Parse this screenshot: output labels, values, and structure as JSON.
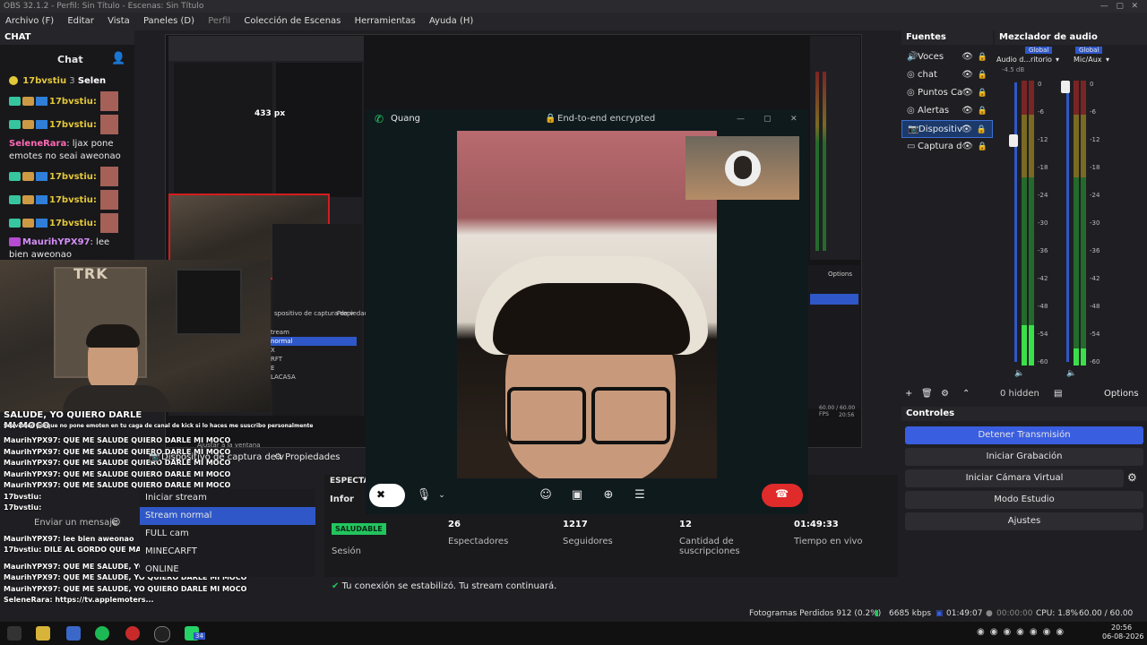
{
  "window": {
    "title": "OBS 32.1.2 - Perfil: Sin Título - Escenas: Sin Título",
    "menu": [
      "Archivo (F)",
      "Editar",
      "Vista",
      "Paneles (D)",
      "Perfil",
      "Colección de Escenas",
      "Herramientas",
      "Ayuda (H)"
    ]
  },
  "chat": {
    "dock_title": "CHAT",
    "header": "Chat",
    "top_user": "17bvstiu",
    "top_count": "3",
    "top_user2": "Selen",
    "lines": [
      {
        "user": "17bvstiu:"
      },
      {
        "user": "17bvstiu:"
      }
    ],
    "msg1_user": "SeleneRara",
    "msg1_text": ": ljax pone emotes no seai aweonao",
    "lines2": [
      {
        "user": "17bvstiu:"
      },
      {
        "user": "17bvstiu:"
      },
      {
        "user": "17bvstiu:"
      }
    ],
    "msg2_user": "MaurihYPX97",
    "msg2_text": ": lee bien aweonao"
  },
  "overlay_chat": [
    "SALUDE, YO QUIERO DARLE",
    "MI MOCO",
    "MaurihYPX97: QUE ME SALUDE QUIERO DARLE MI MOCO",
    "MaurihYPX97: QUE ME SALUDE QUIERO DARLE MI MOCO",
    "MaurihYPX97: QUE ME SALUDE QUIERO DARLE MI MOCO",
    "MaurihYPX97: QUE ME SALUDE QUIERO DARLE MI MOCO",
    "MaurihYPX97: QUE ME SALUDE QUIERO DARLE MI MOCO",
    "17bvstiu:",
    "17bvstiu:",
    "MaurihYPX97: lee bien aweonao",
    "17bvstiu: DILE AL GORDO QUE MAÑANA Y DEJE LA CAGA",
    "MaurihYPX97: QUE ME SALUDE, YO QUIERO DARLE MI MOCO",
    "MaurihYPX97: QUE ME SALUDE, YO QUIERO DARLE MI MOCO",
    "MaurihYPX97: QUE ME SALUDE, YO QUIERO DARLE MI MOCO",
    "SeleneRara: https://tv.applemoters..."
  ],
  "overlay_ticker": "Seaviuseo porque no pone emoten en tu caga de canal de kick si lo haces me suscribo personalmente",
  "chat_input_placeholder": "Enviar un mensaje",
  "preview": {
    "size_label": "433 px",
    "nested_properties": "Propiedades",
    "nested_device": "spositivo de captura de v",
    "nested_scenes": [
      "tream",
      "normal",
      "X",
      "RFT",
      "E",
      "LACASA"
    ],
    "nested_options": "Options",
    "nested_time": "20:56",
    "nested_fps": "60.00 / 60.00 FPS"
  },
  "whatsapp": {
    "caller": "Quang",
    "encryption": "End-to-end encrypted"
  },
  "toolbar": {
    "source_name": "Dispositivo de captura de v",
    "properties": "Propiedades",
    "adjust": "Ajustar a la ventana"
  },
  "scenes": {
    "items": [
      "Iniciar stream",
      "Stream normal",
      "FULL cam",
      "MINECARFT",
      "ONLINE"
    ],
    "selected": 1
  },
  "stream_info": {
    "section_title": "ESPECTAD",
    "info_tab": "Infor",
    "health_badge": "SALUDABLE",
    "health_label": "Sesión",
    "stats": [
      {
        "value": "26",
        "label": "Espectadores"
      },
      {
        "value": "1217",
        "label": "Seguidores"
      },
      {
        "value": "12",
        "label": "Cantidad de suscripciones"
      },
      {
        "value": "01:49:33",
        "label": "Tiempo en vivo"
      }
    ],
    "connection_msg": "Tu conexión se estabilizó. Tu stream continuará."
  },
  "sources": {
    "title": "Fuentes",
    "items": [
      "Voces",
      "chat",
      "Puntos Ca",
      "Alertas",
      "Dispositiv",
      "Captura d"
    ],
    "selected": 4,
    "footer_hidden": "0 hidden"
  },
  "mixer": {
    "title": "Mezclador de audio",
    "ch1_group": "Global",
    "ch1_name": "Audio d...ritorio",
    "ch1_db": "-4.5 dB",
    "ch2_group": "Global",
    "ch2_name": "Mic/Aux",
    "ticks": [
      "0",
      "-6",
      "-12",
      "-18",
      "-24",
      "-30",
      "-36",
      "-42",
      "-48",
      "-54",
      "-60"
    ],
    "options": "Options",
    "ch1_level": 0.14,
    "ch2_level": 0.06
  },
  "controls": {
    "title": "Controles",
    "buttons": [
      "Detener Transmisión",
      "Iniciar Grabación",
      "Iniciar Cámara Virtual",
      "Modo Estudio",
      "Ajustes"
    ]
  },
  "status": {
    "dropped": "Fotogramas Perdidos 912 (0.2%)",
    "bitrate": "6685 kbps",
    "stream_time": "01:49:07",
    "rec_time": "00:00:00",
    "cpu": "CPU: 1.8%",
    "fps": "60.00 / 60.00 FPS"
  },
  "taskbar": {
    "badge": "34",
    "time": "20:56",
    "date": "06-08-2026"
  },
  "colors": {
    "accent": "#3a5ee0",
    "danger": "#e02b2b",
    "health": "#22c55e",
    "success_icon": "#22c55e"
  }
}
